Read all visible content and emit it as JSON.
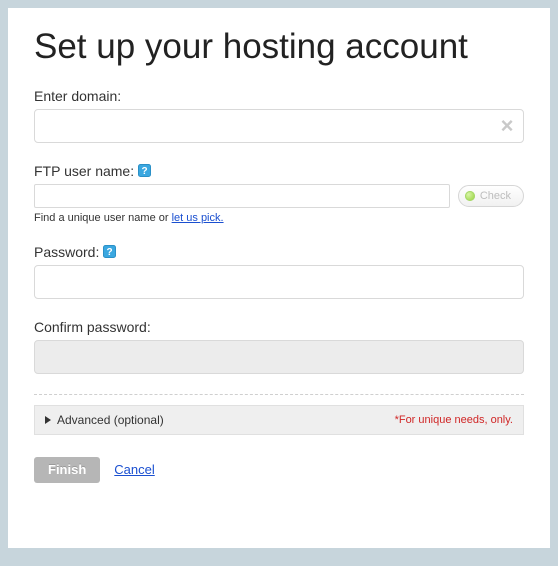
{
  "title": "Set up your hosting account",
  "domain": {
    "label": "Enter domain:",
    "value": ""
  },
  "ftp": {
    "label": "FTP user name:",
    "value": "",
    "check_label": "Check",
    "hint_prefix": "Find a unique user name or ",
    "hint_link": "let us pick."
  },
  "password": {
    "label": "Password:",
    "value": ""
  },
  "confirm": {
    "label": "Confirm password:",
    "value": ""
  },
  "advanced": {
    "label": "Advanced (optional)",
    "note": "*For unique needs, only."
  },
  "actions": {
    "finish": "Finish",
    "cancel": "Cancel"
  }
}
